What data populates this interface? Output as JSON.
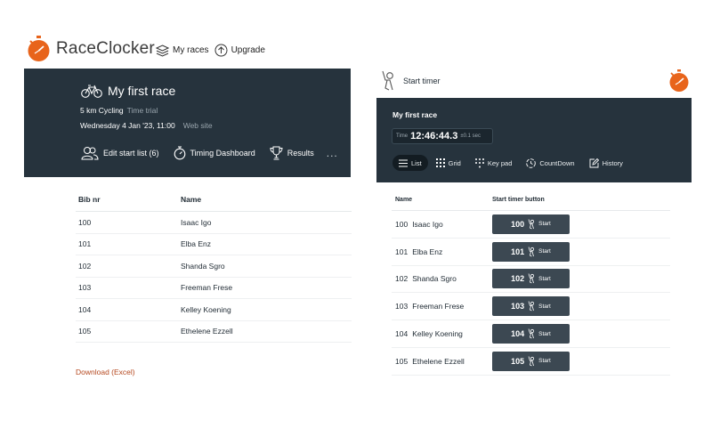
{
  "brand": {
    "name": "RaceClocker",
    "accent": "#e8641b"
  },
  "top_nav": {
    "my_races": "My races",
    "upgrade": "Upgrade"
  },
  "race": {
    "title": "My first race",
    "distance": "5 km Cycling",
    "type": "Time trial",
    "date": "Wednesday 4 Jan '23, 11:00",
    "website": "Web site"
  },
  "card_menu": {
    "edit_start_list": "Edit start list (6)",
    "timing_dashboard": "Timing Dashboard",
    "results": "Results",
    "more": "..."
  },
  "start_list": {
    "columns": [
      "Bib nr",
      "Name"
    ],
    "rows": [
      {
        "bib": "100",
        "name": "Isaac Igo"
      },
      {
        "bib": "101",
        "name": "Elba Enz"
      },
      {
        "bib": "102",
        "name": "Shanda Sgro"
      },
      {
        "bib": "103",
        "name": "Freeman Frese"
      },
      {
        "bib": "104",
        "name": "Kelley Koening"
      },
      {
        "bib": "105",
        "name": "Ethelene Ezzell"
      }
    ]
  },
  "download_label": "Download (Excel)",
  "start_timer": {
    "heading": "Start timer",
    "race_title": "My first race",
    "time_label": "Time",
    "time_value": "12:46:44.3",
    "precision": "±0.1 sec",
    "tabs": [
      "List",
      "Grid",
      "Key pad",
      "CountDown",
      "History"
    ],
    "active_tab": "List",
    "columns": [
      "Name",
      "Start timer button"
    ],
    "start_label": "Start"
  },
  "colors": {
    "dark_panel": "#26333d",
    "button": "#3c4852",
    "link": "#b5481f"
  }
}
